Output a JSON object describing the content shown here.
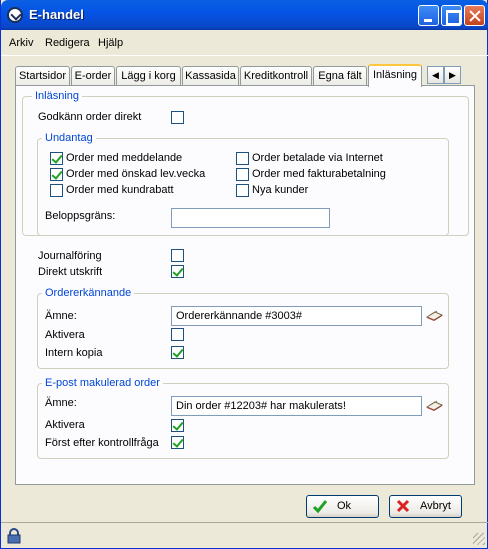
{
  "window": {
    "title": "E-handel"
  },
  "menu": {
    "items": [
      "Arkiv",
      "Redigera",
      "Hjälp"
    ]
  },
  "tabs": [
    "Startsidor",
    "E-order",
    "Lägg i korg",
    "Kassasida",
    "Kreditkontroll",
    "Egna fält",
    "Inläsning"
  ],
  "active_tab": "Inläsning",
  "inlasning": {
    "group_label": "Inläsning",
    "godkann_label": "Godkänn order direkt",
    "godkann_checked": false
  },
  "undantag": {
    "group_label": "Undantag",
    "options": [
      {
        "label": "Order med meddelande",
        "checked": true
      },
      {
        "label": "Order med önskad lev.vecka",
        "checked": true
      },
      {
        "label": "Order med kundrabatt",
        "checked": false
      },
      {
        "label": "Order betalade via Internet",
        "checked": false
      },
      {
        "label": "Order med fakturabetalning",
        "checked": false
      },
      {
        "label": "Nya kunder",
        "checked": false
      }
    ],
    "beloppsgrans_label": "Beloppsgräns:",
    "beloppsgrans_value": ""
  },
  "journalforing": {
    "label": "Journalföring",
    "checked": false
  },
  "direkt_utskrift": {
    "label": "Direkt utskrift",
    "checked": true
  },
  "ordererkannande": {
    "group_label": "Ordererkännande",
    "amne_label": "Ämne:",
    "amne_value": "Ordererkännande #3003#",
    "aktivera_label": "Aktivera",
    "aktivera_checked": false,
    "intern_kopia_label": "Intern kopia",
    "intern_kopia_checked": true
  },
  "epost": {
    "group_label": "E-post makulerad order",
    "amne_label": "Ämne:",
    "amne_value": "Din order #12203# har makulerats!",
    "aktivera_label": "Aktivera",
    "aktivera_checked": true,
    "forst_label": "Först efter kontrollfråga",
    "forst_checked": true
  },
  "buttons": {
    "ok": "Ok",
    "cancel": "Avbryt"
  },
  "colors": {
    "title_blue": "#0454e6",
    "group_label": "#0046d5",
    "check_green": "#21a121"
  }
}
